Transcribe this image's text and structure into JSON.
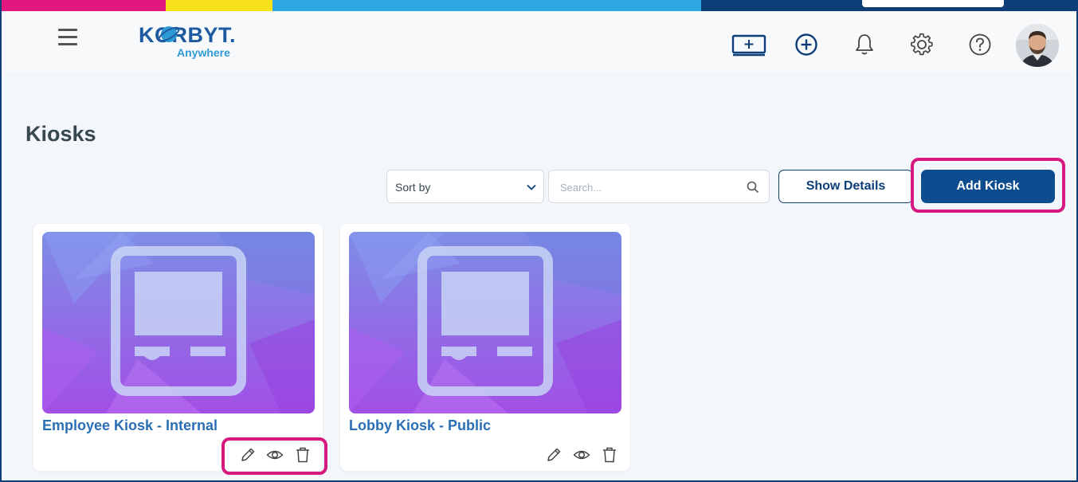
{
  "colors": {
    "bar": [
      "#e2187f",
      "#f7e11b",
      "#2ea7e0",
      "#0d3e77"
    ],
    "accent": "#0d4c8e",
    "highlight": "#d6197e",
    "card_title": "#2a6fb5"
  },
  "header": {
    "logo_main": "KORBYT.",
    "logo_sub": "Anywhere",
    "icons": [
      "display-add-icon",
      "plus-circle-icon",
      "bell-icon",
      "gear-icon",
      "help-icon",
      "avatar"
    ]
  },
  "page": {
    "title": "Kiosks"
  },
  "toolbar": {
    "sort_label": "Sort by",
    "search_placeholder": "Search...",
    "show_details_label": "Show Details",
    "add_label": "Add Kiosk"
  },
  "kiosks": [
    {
      "name": "Employee Kiosk - Internal"
    },
    {
      "name": "Lobby Kiosk - Public"
    }
  ]
}
